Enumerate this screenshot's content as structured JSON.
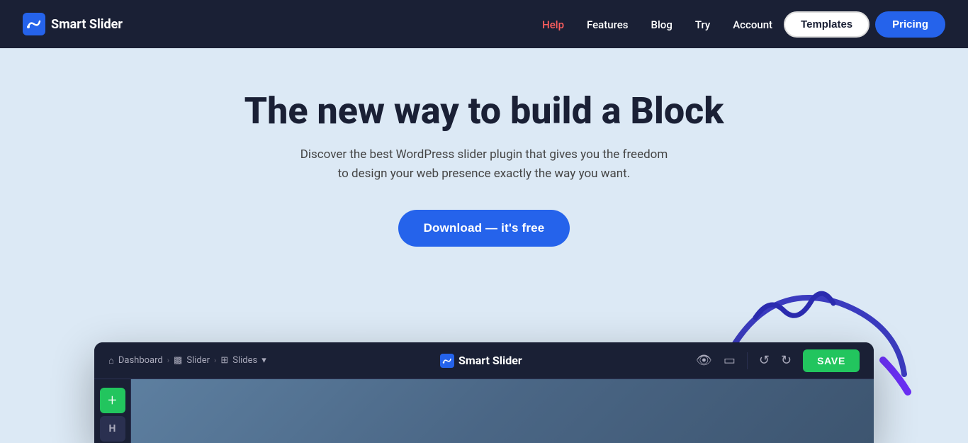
{
  "nav": {
    "logo_text": "Smart Slider",
    "links": [
      {
        "label": "Help",
        "active": true,
        "id": "help"
      },
      {
        "label": "Features",
        "active": false,
        "id": "features"
      },
      {
        "label": "Blog",
        "active": false,
        "id": "blog"
      },
      {
        "label": "Try",
        "active": false,
        "id": "try"
      },
      {
        "label": "Account",
        "active": false,
        "id": "account"
      }
    ],
    "templates_label": "Templates",
    "pricing_label": "Pricing"
  },
  "hero": {
    "title": "The new way to build a Block",
    "subtitle": "Discover the best WordPress slider plugin that gives you the freedom to design your web presence exactly the way you want.",
    "download_label": "Download — it's free"
  },
  "app_preview": {
    "breadcrumb": {
      "dashboard": "Dashboard",
      "slider": "Slider",
      "slides": "Slides"
    },
    "logo": "Smart Slider",
    "save_label": "SAVE",
    "sidebar": {
      "add_label": "+",
      "h_label": "H"
    }
  },
  "colors": {
    "nav_bg": "#1a2035",
    "hero_bg": "#dce9f5",
    "accent_blue": "#2563eb",
    "accent_green": "#22c55e",
    "accent_red": "#ff5e5e",
    "swirl_blue": "#3b3bbf",
    "swirl_purple": "#6b2ff5"
  }
}
